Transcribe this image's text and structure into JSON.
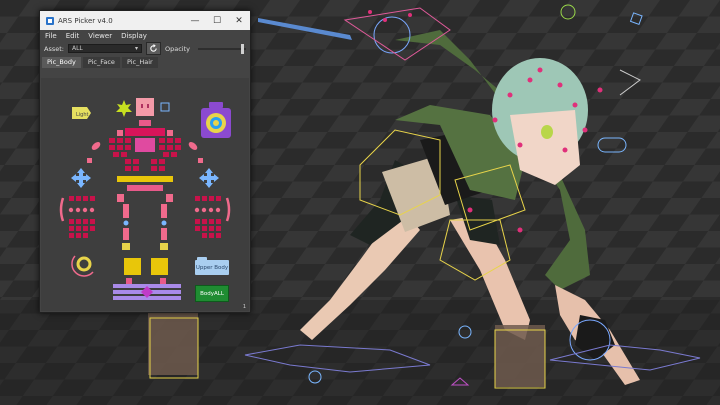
{
  "window": {
    "title": "ARS Picker v4.0",
    "minimize_icon": "minimize-icon",
    "maximize_icon": "maximize-icon",
    "close_icon": "close-icon"
  },
  "menu": [
    "File",
    "Edit",
    "Viewer",
    "Display"
  ],
  "asset_bar": {
    "asset_label": "Asset:",
    "asset_value": "ALL",
    "refresh_icon": "refresh-icon",
    "opacity_label": "Opacity",
    "opacity": 1.0
  },
  "tabs": [
    {
      "label": "Pic_Body",
      "active": true
    },
    {
      "label": "Pic_Face",
      "active": false
    },
    {
      "label": "Pic_Hair",
      "active": false
    }
  ],
  "picker_buttons": {
    "upper_body": "Upper Body",
    "body_all": "BodyALL",
    "light_badge": "Light"
  },
  "page_number": "1",
  "colors": {
    "body_ctrl": "#c8124a",
    "limb_ctrl": "#f06a8c",
    "spine_ctrl": "#e8c60a",
    "head_ctrl": "#f47f94",
    "ik_arrow": "#7ab6ff",
    "root_ctrl": "#a98ae8",
    "root_diamond": "#c03ac8",
    "eye_ctrl": "#9e56d8",
    "viewport_bg": "#2b2b2b"
  }
}
